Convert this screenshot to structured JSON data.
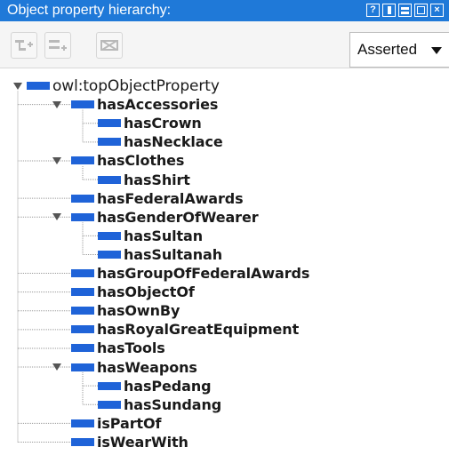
{
  "panel": {
    "title": "Object property hierarchy:",
    "view_controls": [
      "help-icon",
      "view-columns-icon",
      "view-rows-icon",
      "maximize-icon",
      "close-icon"
    ]
  },
  "toolbar": {
    "buttons": [
      "add-sub-property-icon",
      "add-sibling-property-icon",
      "delete-property-icon"
    ],
    "mode": "Asserted"
  },
  "tree": {
    "root": "owl:topObjectProperty",
    "nodes": [
      {
        "label": "hasAccessories",
        "expanded": true,
        "children": [
          "hasCrown",
          "hasNecklace"
        ]
      },
      {
        "label": "hasClothes",
        "expanded": true,
        "children": [
          "hasShirt"
        ]
      },
      {
        "label": "hasFederalAwards",
        "children": []
      },
      {
        "label": "hasGenderOfWearer",
        "expanded": true,
        "children": [
          "hasSultan",
          "hasSultanah"
        ]
      },
      {
        "label": "hasGroupOfFederalAwards",
        "children": []
      },
      {
        "label": "hasObjectOf",
        "children": []
      },
      {
        "label": "hasOwnBy",
        "children": []
      },
      {
        "label": "hasRoyalGreatEquipment",
        "children": []
      },
      {
        "label": "hasTools",
        "children": []
      },
      {
        "label": "hasWeapons",
        "expanded": true,
        "children": [
          "hasPedang",
          "hasSundang"
        ]
      },
      {
        "label": "isPartOf",
        "children": []
      },
      {
        "label": "isWearWith",
        "children": []
      }
    ]
  },
  "colors": {
    "titlebar": "#1f79d8",
    "property_square": "#1f63d8"
  }
}
